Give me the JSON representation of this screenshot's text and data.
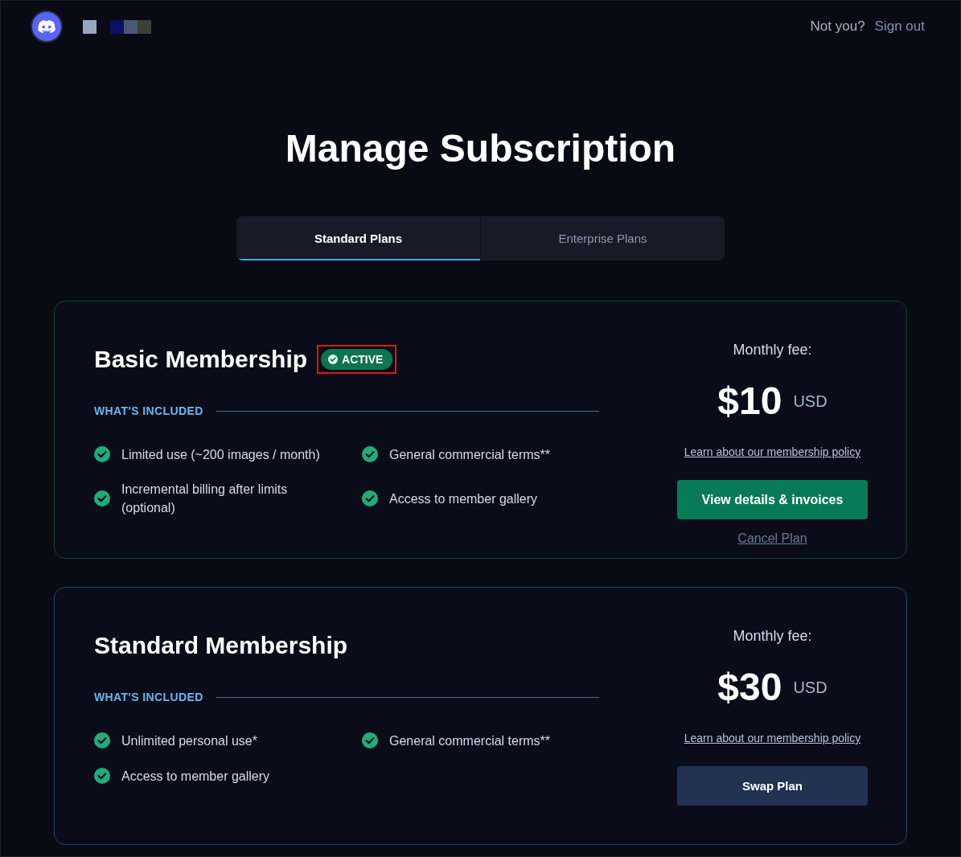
{
  "header": {
    "prompt": "Not you?",
    "sign_out": "Sign out"
  },
  "title": "Manage Subscription",
  "tabs": [
    {
      "label": "Standard Plans",
      "selected": true
    },
    {
      "label": "Enterprise Plans",
      "selected": false
    }
  ],
  "plans": [
    {
      "name": "Basic Membership",
      "active": true,
      "badge": {
        "label": "ACTIVE",
        "highlighted": true
      },
      "section_label": "WHAT'S INCLUDED",
      "features": [
        "Limited use (~200 images / month)",
        "General commercial terms**",
        "Incremental billing after limits (optional)",
        "Access to member gallery"
      ],
      "fee_label": "Monthly fee:",
      "price": "$10",
      "currency": "USD",
      "policy_link": "Learn about our membership policy",
      "action": "View details & invoices",
      "cancel_link": "Cancel Plan"
    },
    {
      "name": "Standard Membership",
      "active": false,
      "section_label": "WHAT'S INCLUDED",
      "features": [
        "Unlimited personal use*",
        "General commercial terms**",
        "Access to member gallery"
      ],
      "fee_label": "Monthly fee:",
      "price": "$30",
      "currency": "USD",
      "policy_link": "Learn about our membership policy",
      "action": "Swap Plan"
    }
  ]
}
